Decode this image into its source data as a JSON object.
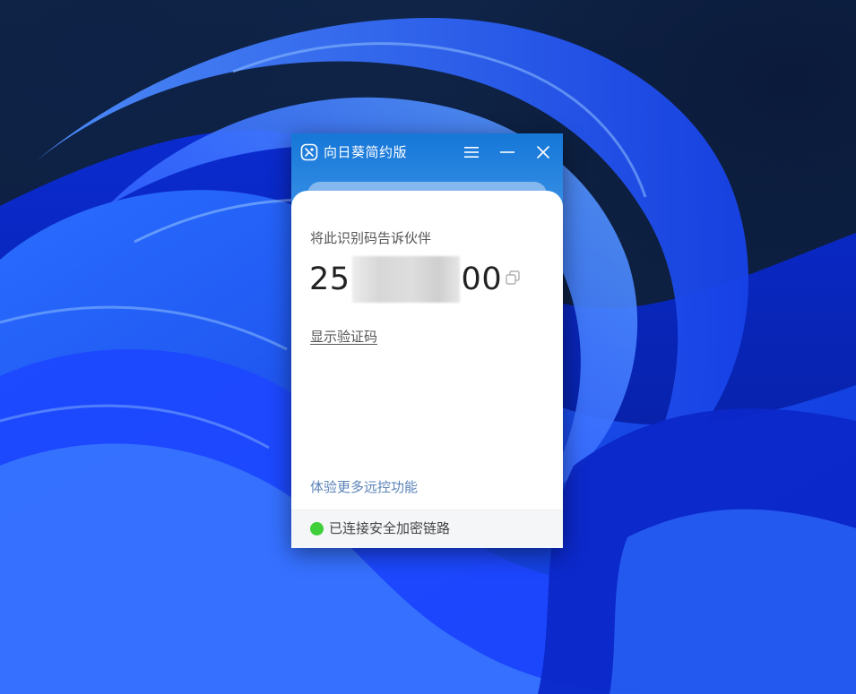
{
  "window": {
    "title": "向日葵简约版",
    "icon": "sunlogin-app-icon",
    "controls": [
      "menu-icon",
      "minimize-icon",
      "close-icon"
    ]
  },
  "main": {
    "id_label": "将此识别码告诉伙伴",
    "id_prefix": "25",
    "id_suffix": "00",
    "show_verify_link": "显示验证码",
    "more_features_link": "体验更多远控功能"
  },
  "status": {
    "text": "已连接安全加密链路",
    "color": "#3fcf3a"
  },
  "colors": {
    "titlebar": "#1677d8",
    "link": "#5a83b8"
  }
}
